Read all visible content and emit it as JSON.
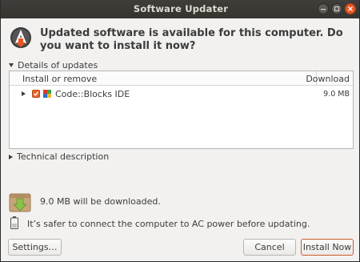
{
  "window": {
    "title": "Software Updater"
  },
  "headline": "Updated software is available for this computer. Do you want to install it now?",
  "details": {
    "expander_label": "Details of updates",
    "columns": {
      "install": "Install or remove",
      "download": "Download"
    },
    "rows": [
      {
        "name": "Code::Blocks IDE",
        "size": "9.0 MB",
        "checked": true
      }
    ]
  },
  "technical": {
    "expander_label": "Technical description"
  },
  "download_info": "9.0 MB will be downloaded.",
  "power_info": "It’s safer to connect the computer to AC power before updating.",
  "buttons": {
    "settings": "Settings…",
    "cancel": "Cancel",
    "install_now": "Install Now"
  },
  "colors": {
    "accent": "#e95420",
    "titlebar": "#3a3935",
    "window_bg": "#f2f1f0"
  },
  "icons": [
    "software-updater-icon",
    "package-icon",
    "battery-icon",
    "close-icon",
    "minimize-icon",
    "maximize-icon"
  ]
}
